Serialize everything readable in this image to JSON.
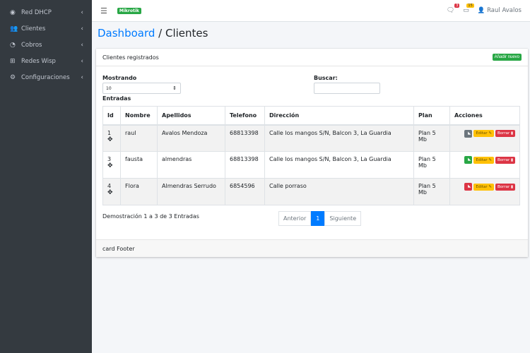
{
  "sidebar": {
    "items": [
      {
        "label": "Red DHCP",
        "icon": "tachometer-icon"
      },
      {
        "label": "Clientes",
        "icon": "users-icon"
      },
      {
        "label": "Cobros",
        "icon": "pie-chart-icon"
      },
      {
        "label": "Redes Wisp",
        "icon": "network-icon"
      },
      {
        "label": "Configuraciones",
        "icon": "cogs-icon"
      }
    ]
  },
  "topbar": {
    "brand": "Mikrotik",
    "messages_badge": "3",
    "notifications_badge": "15",
    "user": "Raul Avalos"
  },
  "breadcrumb": {
    "link": "Dashboard",
    "sep": " / ",
    "current": "Clientes"
  },
  "card": {
    "header": "Clientes registrados",
    "add_button": "Añadir nuevo",
    "show_label": "Mostrando",
    "show_value": "10",
    "entries_label": "Entradas",
    "search_label": "Buscar:",
    "search_value": "",
    "footer": "card Footer"
  },
  "table": {
    "headers": [
      "Id",
      "Nombre",
      "Apellidos",
      "Telefono",
      "Dirección",
      "Plan",
      "Acciones"
    ],
    "rows": [
      {
        "id": "1",
        "nombre": "raul",
        "apellidos": "Avalos Mendoza",
        "telefono": "68813398",
        "direccion": "Calle los mangos S/N, Balcon 3, La Guardia",
        "plan": "Plan 5 Mb",
        "rss_color": "#6c757d"
      },
      {
        "id": "3",
        "nombre": "fausta",
        "apellidos": "almendras",
        "telefono": "68813398",
        "direccion": "Calle los mangos S/N, Balcon 3, La Guardia",
        "plan": "Plan 5 Mb",
        "rss_color": "#28a745"
      },
      {
        "id": "4",
        "nombre": "Flora",
        "apellidos": "Almendras Serrudo",
        "telefono": "6854596",
        "direccion": "Calle porraso",
        "plan": "Plan 5 Mb",
        "rss_color": "#dc3545"
      }
    ],
    "edit_label": "Editar",
    "delete_label": "Borrar"
  },
  "pagination": {
    "info": "Demostración 1 a 3 de 3 Entradas",
    "prev": "Anterior",
    "current": "1",
    "next": "Siguiente"
  }
}
